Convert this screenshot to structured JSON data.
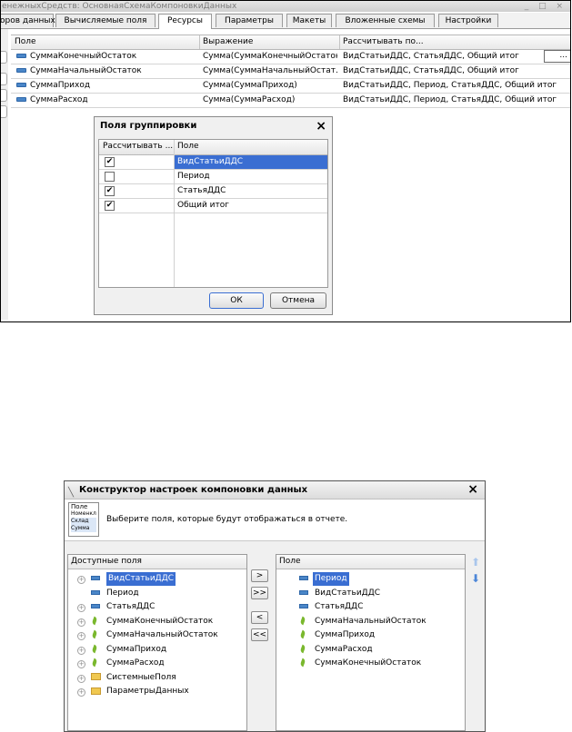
{
  "top_window": {
    "title": "енежныхСредств: ОсновнаяСхемаКомпоновкиДанных",
    "controls": "_ □ ×",
    "tabs": [
      "оров данных",
      "Вычисляемые поля",
      "Ресурсы",
      "Параметры",
      "Макеты",
      "Вложенные схемы",
      "Настройки"
    ],
    "active_tab": "Ресурсы",
    "table": {
      "headers": [
        "Поле",
        "Выражение",
        "Рассчитывать по..."
      ],
      "rows": [
        {
          "field": "СуммаКонечныйОстаток",
          "expr": "Сумма(СуммаКонечныйОстаток)",
          "calc": "ВидСтатьиДДС, СтатьяДДС, Общий итог"
        },
        {
          "field": "СуммаНачальныйОстаток",
          "expr": "Сумма(СуммаНачальныйОстат...",
          "calc": "ВидСтатьиДДС, СтатьяДДС, Общий итог"
        },
        {
          "field": "СуммаПриход",
          "expr": "Сумма(СуммаПриход)",
          "calc": "ВидСтатьиДДС, Период, СтатьяДДС, Общий итог"
        },
        {
          "field": "СуммаРасход",
          "expr": "Сумма(СуммаРасход)",
          "calc": "ВидСтатьиДДС, Период, СтатьяДДС, Общий итог"
        }
      ],
      "ellipsis": "..."
    }
  },
  "dialog": {
    "title": "Поля группировки",
    "close": "×",
    "headers": [
      "Рассчитывать ...",
      "Поле"
    ],
    "rows": [
      {
        "checked": true,
        "field": "ВидСтатьиДДС"
      },
      {
        "checked": false,
        "field": "Период"
      },
      {
        "checked": true,
        "field": "СтатьяДДС"
      },
      {
        "checked": true,
        "field": "Общий итог"
      }
    ],
    "ok": "ОК",
    "cancel": "Отмена"
  },
  "bottom_window": {
    "title": "Конструктор настроек компоновки данных",
    "close": "×",
    "legend": [
      "Поле",
      "Номенклатура",
      "Склад",
      "Сумма"
    ],
    "hint": "Выберите поля, которые будут отображаться в отчете.",
    "available_header": "Доступные поля",
    "available": [
      {
        "label": "ВидСтатьиДДС",
        "icon": "dash",
        "expand": true
      },
      {
        "label": "Период",
        "icon": "dash",
        "expand": false
      },
      {
        "label": "СтатьяДДС",
        "icon": "dash",
        "expand": true
      },
      {
        "label": "СуммаКонечныйОстаток",
        "icon": "resource",
        "expand": true
      },
      {
        "label": "СуммаНачальныйОстаток",
        "icon": "resource",
        "expand": true
      },
      {
        "label": "СуммаПриход",
        "icon": "resource",
        "expand": true
      },
      {
        "label": "СуммаРасход",
        "icon": "resource",
        "expand": true
      },
      {
        "label": "СистемныеПоля",
        "icon": "folder",
        "expand": true
      },
      {
        "label": "ПараметрыДанных",
        "icon": "folder",
        "expand": true
      }
    ],
    "selected_header": "Поле",
    "selected": [
      {
        "label": "Период",
        "icon": "dash"
      },
      {
        "label": "ВидСтатьиДДС",
        "icon": "dash"
      },
      {
        "label": "СтатьяДДС",
        "icon": "dash"
      },
      {
        "label": "СуммаНачальныйОстаток",
        "icon": "resource"
      },
      {
        "label": "СуммаПриход",
        "icon": "resource"
      },
      {
        "label": "СуммаРасход",
        "icon": "resource"
      },
      {
        "label": "СуммаКонечныйОстаток",
        "icon": "resource"
      }
    ],
    "move_buttons": [
      ">",
      ">>",
      "<",
      "<<"
    ],
    "accent": "#3a6ed2"
  }
}
